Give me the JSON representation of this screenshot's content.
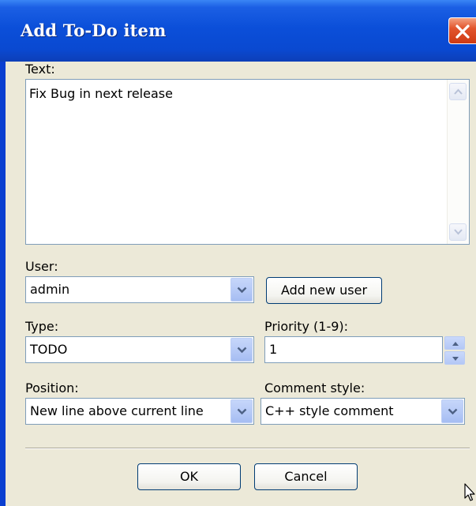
{
  "window": {
    "title": "Add To-Do item"
  },
  "text_section": {
    "label": "Text:",
    "value": "Fix Bug in next release"
  },
  "user": {
    "label": "User:",
    "selected": "admin",
    "add_button": "Add new user"
  },
  "type": {
    "label": "Type:",
    "selected": "TODO"
  },
  "priority": {
    "label": "Priority (1-9):",
    "value": "1"
  },
  "position": {
    "label": "Position:",
    "selected": "New line above current line"
  },
  "comment_style": {
    "label": "Comment style:",
    "selected": "C++ style comment"
  },
  "buttons": {
    "ok": "OK",
    "cancel": "Cancel"
  },
  "colors": {
    "titlebar": "#0a49d1",
    "client_bg": "#ece9d8",
    "close_button": "#e2552d",
    "field_border": "#7f9db9"
  }
}
